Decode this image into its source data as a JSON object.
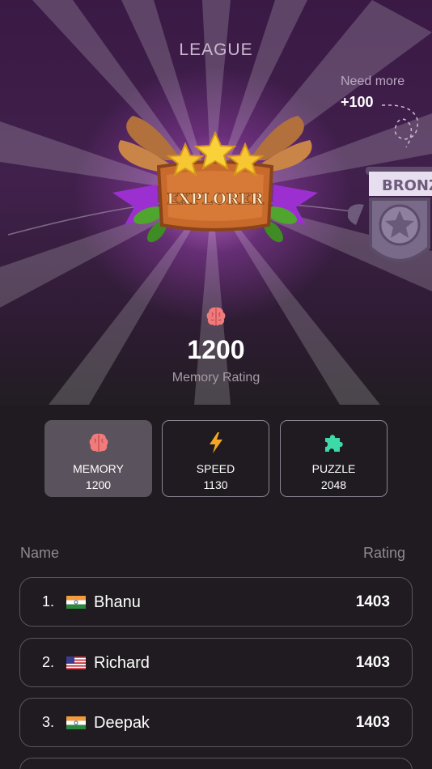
{
  "header": {
    "title": "LEAGUE"
  },
  "next_league": {
    "need_label": "Need more",
    "need_value": "+100",
    "name": "BRONZE"
  },
  "current_league": {
    "name": "EXPLORER"
  },
  "rating": {
    "value": "1200",
    "caption": "Memory Rating",
    "icon": "brain-icon"
  },
  "categories": [
    {
      "label": "MEMORY",
      "value": "1200",
      "icon": "brain-icon",
      "active": true,
      "color": "#ef7b7b"
    },
    {
      "label": "SPEED",
      "value": "1130",
      "icon": "lightning-icon",
      "active": false,
      "color": "#f5a623"
    },
    {
      "label": "PUZZLE",
      "value": "2048",
      "icon": "puzzle-icon",
      "active": false,
      "color": "#3fd9a8"
    }
  ],
  "leaderboard": {
    "col_name": "Name",
    "col_rating": "Rating",
    "rows": [
      {
        "rank": "1.",
        "flag": "india-flag",
        "name": "Bhanu",
        "rating": "1403"
      },
      {
        "rank": "2.",
        "flag": "usa-flag",
        "name": "Richard",
        "rating": "1403"
      },
      {
        "rank": "3.",
        "flag": "india-flag",
        "name": "Deepak",
        "rating": "1403"
      },
      {
        "rank": "",
        "flag": "",
        "name": "",
        "rating": ""
      }
    ]
  }
}
